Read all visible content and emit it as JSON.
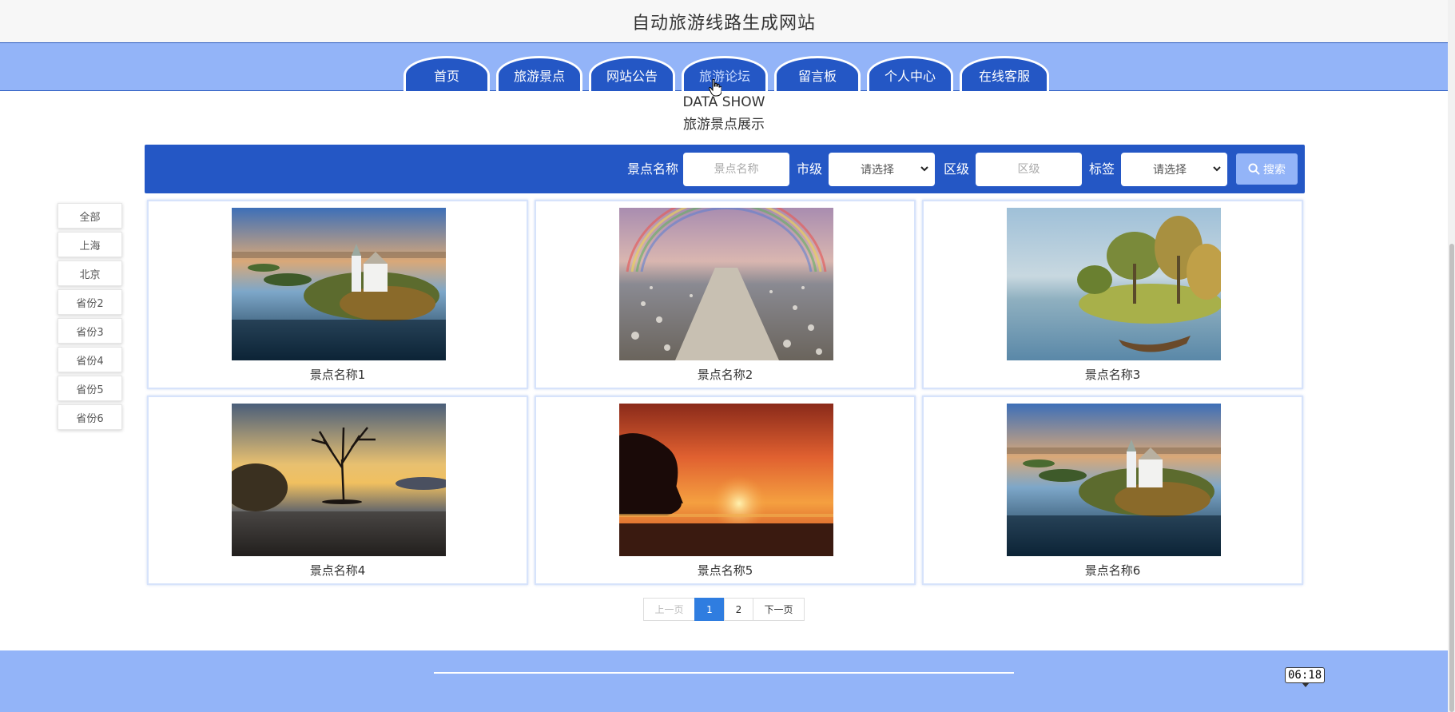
{
  "site": {
    "title": "自动旅游线路生成网站"
  },
  "nav": {
    "tabs": [
      {
        "label": "首页"
      },
      {
        "label": "旅游景点"
      },
      {
        "label": "网站公告"
      },
      {
        "label": "旅游论坛"
      },
      {
        "label": "留言板"
      },
      {
        "label": "个人中心"
      },
      {
        "label": "在线客服"
      }
    ],
    "active_tab": "旅游论坛"
  },
  "section": {
    "title_en": "DATA SHOW",
    "title_cn": "旅游景点展示"
  },
  "search": {
    "name_label": "景点名称",
    "name_placeholder": "景点名称",
    "city_label": "市级",
    "city_value": "请选择",
    "district_label": "区级",
    "district_placeholder": "区级",
    "tag_label": "标签",
    "tag_value": "请选择",
    "button_label": "搜索",
    "button_icon": "search-icon"
  },
  "sidebar": {
    "items": [
      {
        "label": "全部"
      },
      {
        "label": "上海"
      },
      {
        "label": "北京"
      },
      {
        "label": "省份2"
      },
      {
        "label": "省份3"
      },
      {
        "label": "省份4"
      },
      {
        "label": "省份5"
      },
      {
        "label": "省份6"
      }
    ]
  },
  "cards": [
    {
      "name": "景点名称1",
      "image": "lake-castle-island"
    },
    {
      "name": "景点名称2",
      "image": "rainbow-flower-path"
    },
    {
      "name": "景点名称3",
      "image": "painted-lake-boat"
    },
    {
      "name": "景点名称4",
      "image": "lone-tree-lake-sunset"
    },
    {
      "name": "景点名称5",
      "image": "orange-sunset-beach"
    },
    {
      "name": "景点名称6",
      "image": "lake-castle-island"
    }
  ],
  "pagination": {
    "prev": "上一页",
    "pages": [
      "1",
      "2"
    ],
    "current": "1",
    "next": "下一页"
  },
  "overlay": {
    "timestamp": "06:18"
  },
  "colors": {
    "primary": "#2457c5",
    "light": "#93b4f8",
    "page_active": "#2f7de0"
  }
}
